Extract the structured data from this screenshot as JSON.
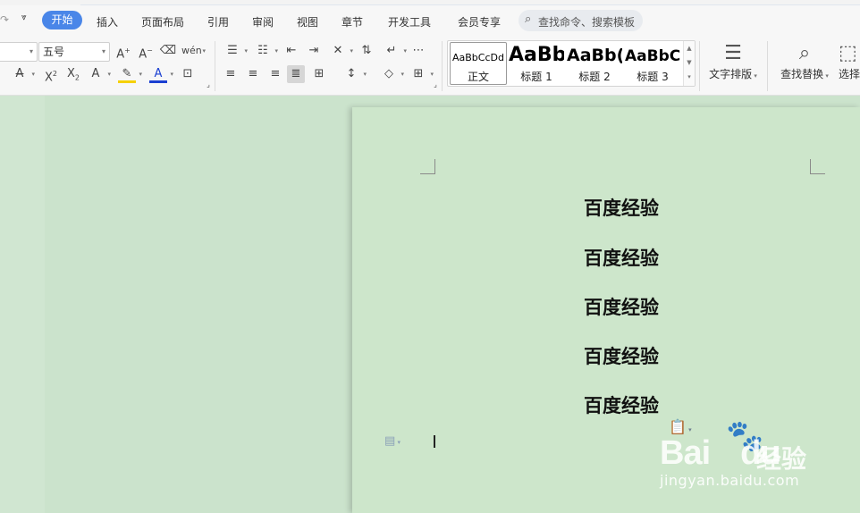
{
  "menubar": {
    "tabs": [
      "开始",
      "插入",
      "页面布局",
      "引用",
      "审阅",
      "视图",
      "章节",
      "开发工具",
      "会员专享"
    ],
    "active_tab": "开始",
    "search_placeholder": "查找命令、搜索模板"
  },
  "ribbon": {
    "font_size_value": "五号",
    "styles": [
      {
        "sample": "AaBbCcDd",
        "label": "正文"
      },
      {
        "sample": "AaBb",
        "label": "标题 1"
      },
      {
        "sample": "AaBb(",
        "label": "标题 2"
      },
      {
        "sample": "AaBbC(",
        "label": "标题 3"
      }
    ],
    "text_layout_label": "文字排版",
    "find_replace_label": "查找替换",
    "select_label": "选择"
  },
  "document": {
    "lines": [
      "百度经验",
      "百度经验",
      "百度经验",
      "百度经验",
      "百度经验"
    ]
  },
  "watermark": {
    "logo": "Bai",
    "logo_du": "du",
    "cn": "经验",
    "url": "jingyan.baidu.com"
  },
  "colors": {
    "accent": "#4a86e8",
    "page_bg": "#cde6cb",
    "highlight": "#f5d000",
    "font_color": "#1a3fd1"
  }
}
